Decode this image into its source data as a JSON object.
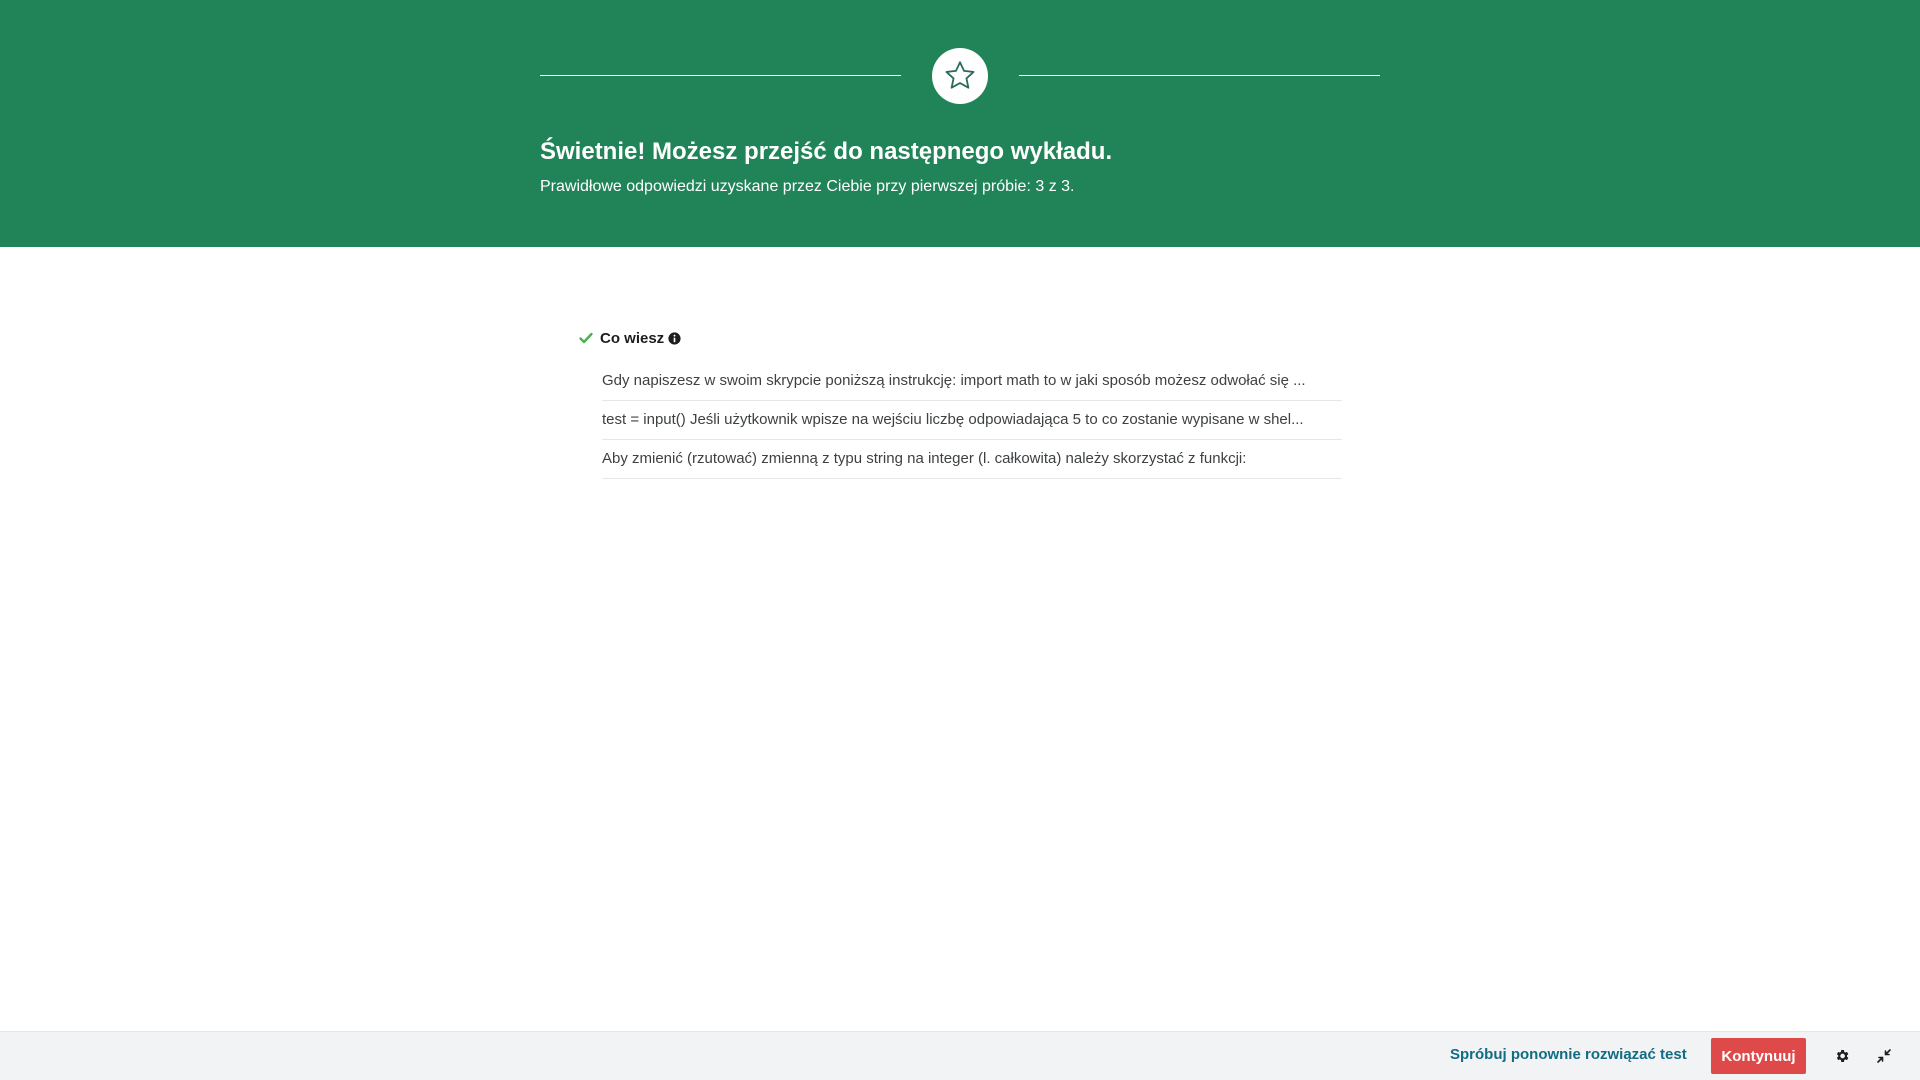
{
  "banner": {
    "title": "Świetnie! Możesz przejść do następnego wykładu.",
    "subtitle": "Prawidłowe odpowiedzi uzyskane przez Ciebie przy pierwszej próbie: 3 z 3.",
    "icon": "star-icon",
    "background_color": "#218459"
  },
  "summary": {
    "heading": "Co wiesz",
    "heading_icon": "check-icon",
    "info_icon": "info-icon",
    "check_color": "#4caf50",
    "questions": [
      "Gdy napiszesz w swoim skrypcie poniższą instrukcję: import math to w jaki sposób możesz odwołać się ...",
      "test = input() Jeśli użytkownik wpisze na wejściu liczbę odpowiadająca 5 to co zostanie wypisane w shel...",
      "Aby zmienić (rzutować) zmienną z typu string na integer (l. całkowita) należy skorzystać z funkcji:"
    ]
  },
  "footer": {
    "retry_label": "Spróbuj ponownie rozwiązać test",
    "continue_label": "Kontynuuj",
    "settings_icon": "gear-icon",
    "collapse_icon": "collapse-icon",
    "accent_color": "#de4a4a",
    "link_color": "#126c84"
  }
}
